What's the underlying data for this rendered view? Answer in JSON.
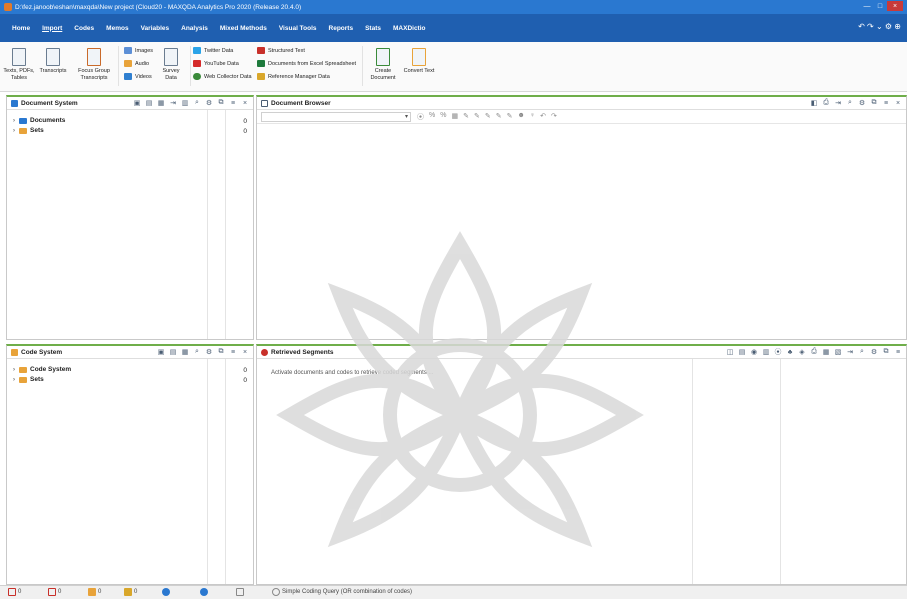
{
  "window": {
    "title": "D:\\fez.janoob\\eshan\\maxqda\\New project (Cloud20 - MAXQDA Analytics Pro 2020 (Release 20.4.0)",
    "minimize": "—",
    "maximize": "□",
    "close": "×"
  },
  "menu": {
    "tabs": [
      "Home",
      "Import",
      "Codes",
      "Memos",
      "Variables",
      "Analysis",
      "Mixed Methods",
      "Visual Tools",
      "Reports",
      "Stats",
      "MAXDictio"
    ],
    "active": "Import",
    "right_icons": [
      "undo-icon",
      "redo-icon",
      "chevron-down-icon",
      "gear-icon",
      "globe-icon"
    ],
    "right_glyphs": "↶ ↷  ⌄ ⚙ ⊕"
  },
  "ribbon": {
    "texts_pdfs": "Texts, PDFs, Tables",
    "transcripts": "Transcripts",
    "focus_group": "Focus Group Transcripts",
    "images": "Images",
    "audio": "Audio",
    "videos": "Videos",
    "survey_data": "Survey Data",
    "twitter": "Twitter Data",
    "youtube": "YouTube Data",
    "web_collector": "Web Collector Data",
    "structured_text": "Structured Text",
    "excel": "Documents from Excel Spreadsheet",
    "reference_manager": "Reference Manager Data",
    "create_document": "Create Document",
    "convert_text": "Convert Text"
  },
  "document_system": {
    "title": "Document System",
    "items": [
      {
        "label": "Documents",
        "count": "0"
      },
      {
        "label": "Sets",
        "count": "0"
      }
    ]
  },
  "document_browser": {
    "title": "Document Browser",
    "select_value": ""
  },
  "code_system": {
    "title": "Code System",
    "items": [
      {
        "label": "Code System",
        "count": "0"
      },
      {
        "label": "Sets",
        "count": "0"
      }
    ]
  },
  "retrieved_segments": {
    "title": "Retrieved Segments",
    "message": "Activate documents and codes to retrieve coded segments ..."
  },
  "statusbar": {
    "items": [
      {
        "icon": "documents-count-icon",
        "text": "0"
      },
      {
        "icon": "codes-count-icon",
        "text": "0"
      },
      {
        "icon": "coded-segments-icon",
        "text": "0"
      },
      {
        "icon": "memos-count-icon",
        "text": "0"
      },
      {
        "icon": "user-icon",
        "text": ""
      },
      {
        "icon": "users-icon",
        "text": ""
      },
      {
        "icon": "page-icon",
        "text": ""
      }
    ],
    "query": "Simple Coding Query (OR combination of codes)"
  },
  "colors": {
    "title_bar": "#2a78d0",
    "menu_bar": "#1f5fb0",
    "pane_accent": "#6fae4a",
    "folder": "#e8a33a"
  }
}
